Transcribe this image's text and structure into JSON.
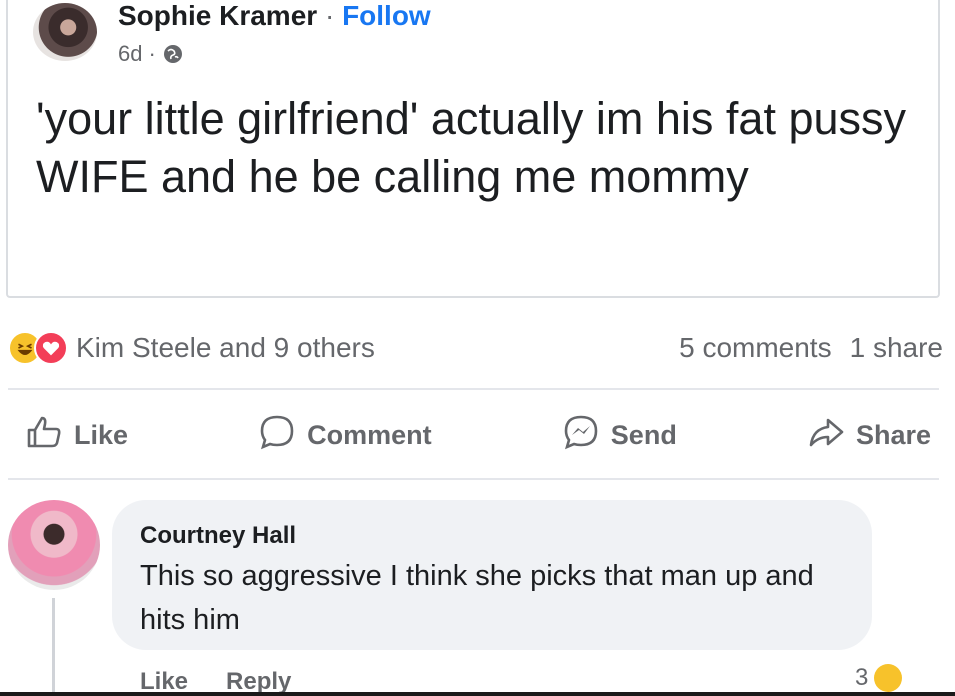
{
  "post": {
    "author": "Sophie Kramer",
    "separator": "·",
    "follow_label": "Follow",
    "age": "6d",
    "meta_separator": "·",
    "privacy_icon": "globe-icon",
    "text": "'your little girlfriend' actually im his fat pussy WIFE and he be calling me mommy"
  },
  "reactions": {
    "icons": [
      "haha-icon",
      "love-icon"
    ],
    "summary": "Kim Steele and 9 others",
    "comments": "5 comments",
    "shares": "1 share"
  },
  "actions": {
    "like": "Like",
    "comment": "Comment",
    "send": "Send",
    "share": "Share"
  },
  "comment": {
    "author": "Courtney Hall",
    "text": "This so aggressive I think she picks that man up and hits him",
    "like": "Like",
    "reply": "Reply",
    "reaction_count": "3"
  },
  "colors": {
    "accent": "#1877f2",
    "text": "#1c1e21",
    "muted": "#65676b",
    "bubble": "#f0f2f5",
    "haha": "#f7c22b",
    "love": "#f33e58"
  }
}
